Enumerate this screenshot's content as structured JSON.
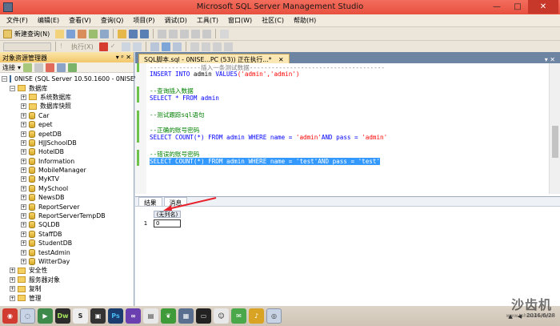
{
  "window": {
    "title": "Microsoft SQL Server Management Studio"
  },
  "menu": [
    "文件(F)",
    "编辑(E)",
    "查看(V)",
    "查询(Q)",
    "项目(P)",
    "调试(D)",
    "工具(T)",
    "窗口(W)",
    "社区(C)",
    "帮助(H)"
  ],
  "toolbar": {
    "new_query": "新建查询(N)",
    "execute": "执行(X)"
  },
  "explorer": {
    "title": "对象资源管理器",
    "connect_label": "连接",
    "server_node": "0NISE (SQL Server 10.50.1600 - 0NISE\\a",
    "databases_label": "数据库",
    "system_db_label": "系统数据库",
    "snapshot_label": "数据库快照",
    "databases": [
      "Car",
      "epet",
      "epetDB",
      "HJJSchoolDB",
      "HotelDB",
      "Information",
      "MobileManager",
      "MyKTV",
      "MySchool",
      "NewsDB",
      "ReportServer",
      "ReportServerTempDB",
      "SQLDB",
      "StaffDB",
      "StudentDB",
      "testAdmin",
      "WitterDay"
    ],
    "security_label": "安全性",
    "server_objects_label": "服务器对象",
    "replication_label": "复制",
    "management_label": "管理"
  },
  "editor": {
    "tab_title": "SQL脚本.sql - 0NISE...PC (53)) 正在执行...*",
    "code": {
      "line0": "--------------插入一条测试数据-------------------------------------",
      "line1_kw1": "INSERT INTO",
      "line1_mid": " admin ",
      "line1_kw2": "VALUES",
      "line1_rest": "('admin','admin')",
      "comment_query": "--查询插入数据",
      "select_all": "SELECT * FROM admin",
      "comment_trace": "--测试跟踪sql语句",
      "comment_correct": "--正确的账号密码",
      "select_correct_pre": "SELECT COUNT(*) FROM admin WHERE name = ",
      "select_correct_str1": "'admin'",
      "select_correct_mid": "AND pass = ",
      "select_correct_str2": "'admin'",
      "comment_wrong": "--错误的账号密码",
      "select_wrong": "SELECT COUNT(*) FROM admin WHERE name = 'test'AND pass = 'test'"
    }
  },
  "results": {
    "tab_results": "结果",
    "tab_messages": "消息",
    "column_header": "(无列名)",
    "row_number": "1",
    "cell_value": "0"
  },
  "taskbar": {
    "apps": [
      "Dw",
      "S",
      "Ps"
    ],
    "clock_date": "2016/6/28"
  },
  "watermark": {
    "main": "沙齿机",
    "sub": "www.tehrasde.com"
  }
}
